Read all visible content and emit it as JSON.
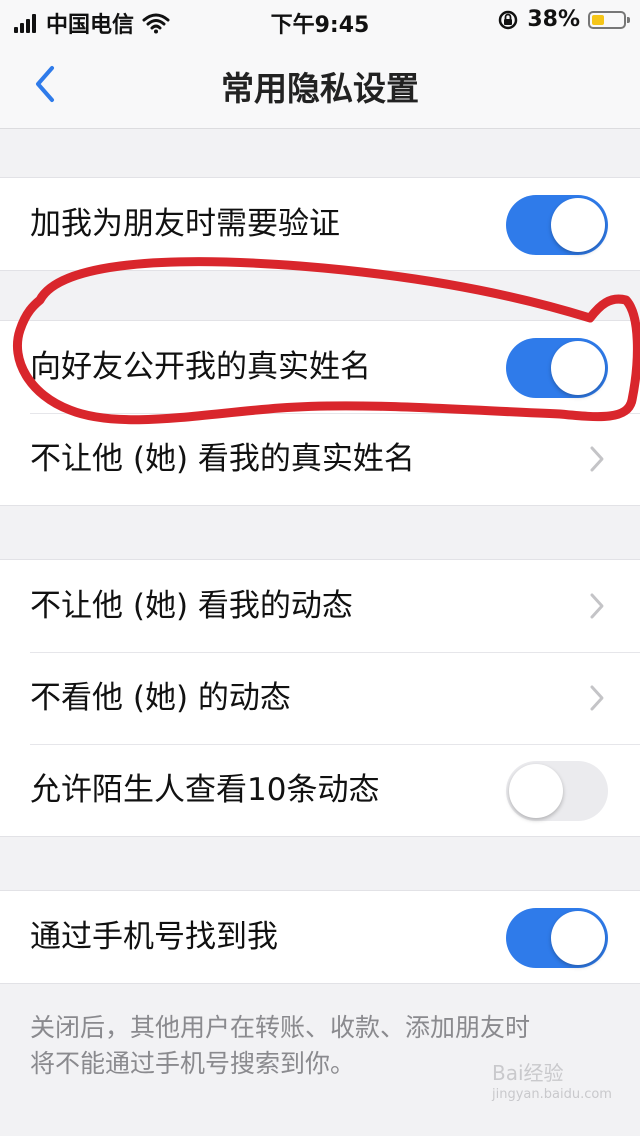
{
  "status_bar": {
    "carrier": "中国电信",
    "time": "下午9:45",
    "battery_percent": "38%",
    "battery_level": 0.38,
    "icons": [
      "signal-icon",
      "wifi-icon",
      "rotation-lock-icon",
      "battery-icon"
    ]
  },
  "nav": {
    "title": "常用隐私设置",
    "back_icon": "chevron-left-icon"
  },
  "groups": [
    {
      "rows": [
        {
          "label": "加我为朋友时需要验证",
          "control": "toggle",
          "on": true
        }
      ]
    },
    {
      "rows": [
        {
          "label": "向好友公开我的真实姓名",
          "control": "toggle",
          "on": true
        },
        {
          "label": "不让他 (她) 看我的真实姓名",
          "control": "chevron"
        }
      ]
    },
    {
      "rows": [
        {
          "label": "不让他 (她) 看我的动态",
          "control": "chevron"
        },
        {
          "label": "不看他 (她) 的动态",
          "control": "chevron"
        },
        {
          "label": "允许陌生人查看10条动态",
          "control": "toggle",
          "on": false
        }
      ]
    },
    {
      "rows": [
        {
          "label": "通过手机号找到我",
          "control": "toggle",
          "on": true
        }
      ]
    }
  ],
  "footer": {
    "line1": "关闭后，其他用户在转账、收款、添加朋友时",
    "line2": "将不能通过手机号搜索到你。"
  },
  "watermark": {
    "brand": "Bai经验",
    "url": "jingyan.baidu.com"
  },
  "colors": {
    "toggle_on": "#2f7bea",
    "annotation": "#d9262c",
    "battery": "#f5c518"
  }
}
